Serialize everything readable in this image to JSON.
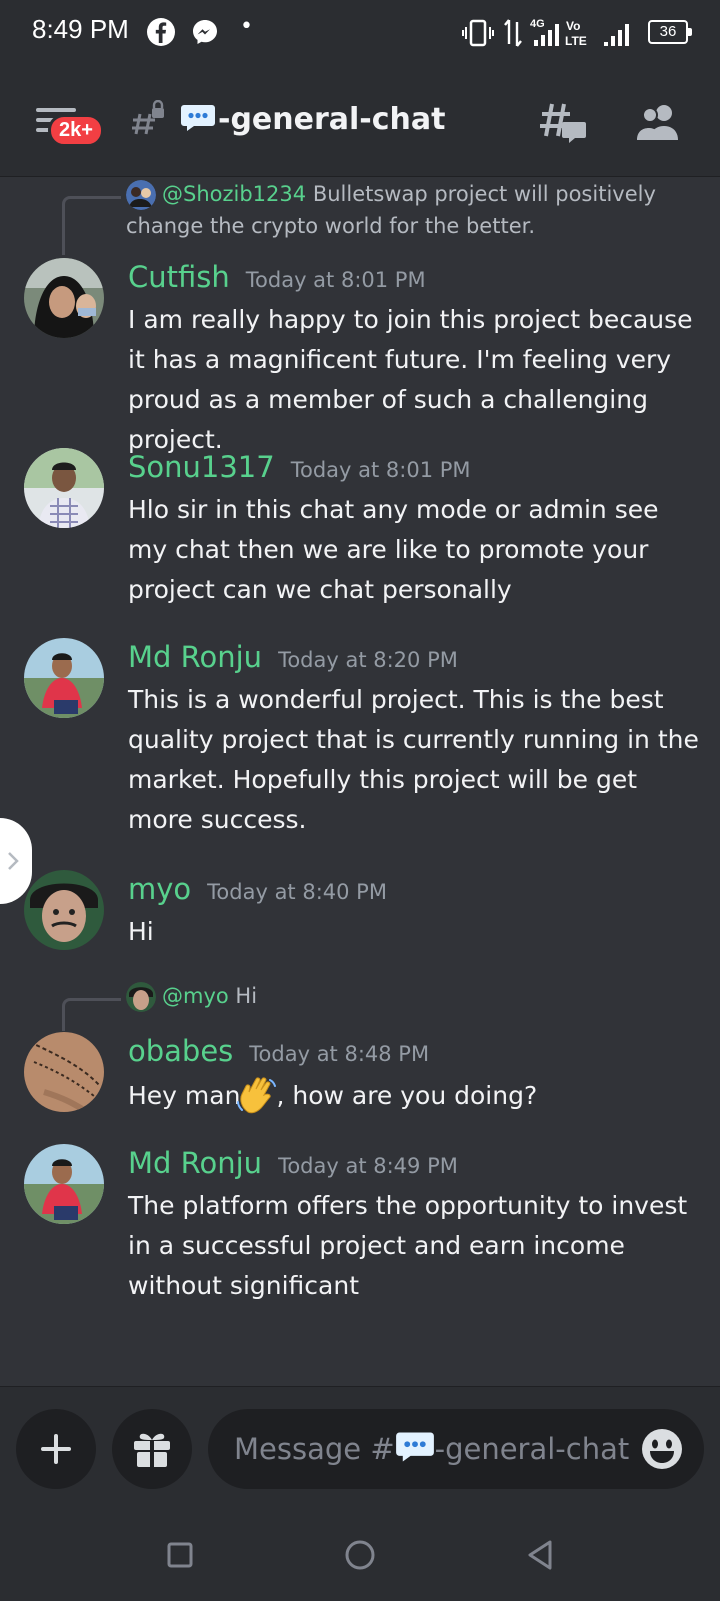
{
  "status_bar": {
    "time": "8:49 PM",
    "dot": "•",
    "network_4g": "4G",
    "volte": "Vo LTE",
    "battery": "36"
  },
  "header": {
    "badge": "2k+",
    "channel_name": "-general-chat"
  },
  "messages": [
    {
      "reply": {
        "mention": "@Shozib1234",
        "text": "Bulletswap project will positively change the crypto world for the better."
      },
      "username": "Cutfish",
      "timestamp": "Today at 8:01 PM",
      "text": "I am really happy to join this project because it has a magnificent future. I'm feeling very proud as a member of such a challenging project."
    },
    {
      "username": "Sonu1317",
      "timestamp": "Today at 8:01 PM",
      "text": "Hlo sir in this chat any mode or admin see my chat then we are like to promote your project can we chat personally"
    },
    {
      "username": "Md Ronju",
      "timestamp": "Today at 8:20 PM",
      "text": "This is a wonderful project. This is the best quality project that is currently running in the market. Hopefully this project will be get more success."
    },
    {
      "username": "myo",
      "timestamp": "Today at 8:40 PM",
      "text": "Hi"
    },
    {
      "reply": {
        "mention": "@myo",
        "text": "Hi"
      },
      "username": "obabes",
      "timestamp": "Today at 8:48 PM",
      "text_before": "Hey man",
      "text_after": ", how are you doing?"
    },
    {
      "username": "Md Ronju",
      "timestamp": "Today at 8:49 PM",
      "text": "The platform offers the opportunity to invest in a successful project and earn income without significant"
    }
  ],
  "composer": {
    "placeholder_prefix": "Message #",
    "placeholder_channel": "-general-chat"
  },
  "colors": {
    "background": "#313338",
    "username": "#58d18d",
    "badge": "#f23f43"
  }
}
